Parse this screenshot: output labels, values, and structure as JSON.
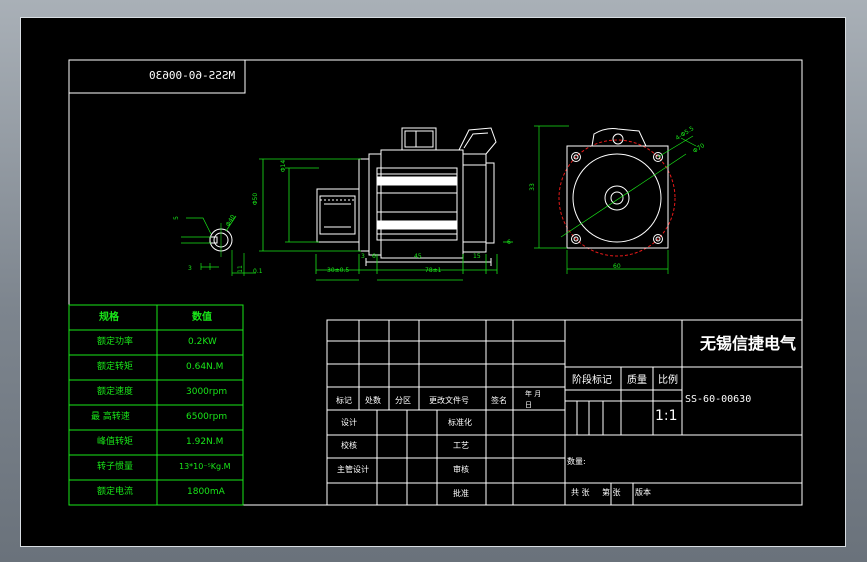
{
  "drawing": {
    "mirrored_code": "MSSS-60-00630",
    "part_code": "SS-60-00630",
    "company": "无锡信捷电气",
    "scale": "1:1"
  },
  "spec_table": {
    "header_param": "规格",
    "header_value": "数值",
    "rows": [
      {
        "param": "额定功率",
        "value": "0.2KW"
      },
      {
        "param": "额定转矩",
        "value": "0.64N.M"
      },
      {
        "param": "额定速度",
        "value": "3000rpm"
      },
      {
        "param": "最 高转速",
        "value": "6500rpm"
      },
      {
        "param": "峰值转矩",
        "value": "1.92N.M"
      },
      {
        "param": "转子惯量",
        "value": "13*10⁻⁵Kg.M"
      },
      {
        "param": "额定电流",
        "value": "1800mA"
      }
    ]
  },
  "title_block": {
    "col_mark": "标记",
    "col_count": "处数",
    "col_zone": "分区",
    "col_doc": "更改文件号",
    "col_sign": "签名",
    "col_date_year": "年 月",
    "col_date_day": "日",
    "design": "设计",
    "standardize": "标准化",
    "check": "校核",
    "process": "工艺",
    "chief_design": "主管设计",
    "review": "审核",
    "approve": "批准",
    "stage_mark": "阶段标记",
    "weight": "质量",
    "ratio": "比例",
    "quantity": "数量:",
    "sheets_total": "共 张",
    "sheet_no": "第 张",
    "version": "版本"
  },
  "dimensions": {
    "front_width": "60",
    "front_height": "33",
    "bolt_circle": "4-Φ5.5",
    "pcd": "Φ70",
    "length_total": "78±1",
    "flange_len": "30±0.5",
    "shaft_len": "45",
    "pilot": "Φ50",
    "shaft_dia": "Φ14",
    "body_dia": "Φ40",
    "key_w": "5",
    "key_h": "11",
    "key_depth": "3",
    "small_a": "6",
    "small_b": "3",
    "small_c": "15",
    "small_d": "6",
    "small_e": "0.1"
  },
  "colors": {
    "line": "#ffffff",
    "text_green": "#19e619",
    "dim_green": "#19e619",
    "hidden_red": "#e61919"
  }
}
